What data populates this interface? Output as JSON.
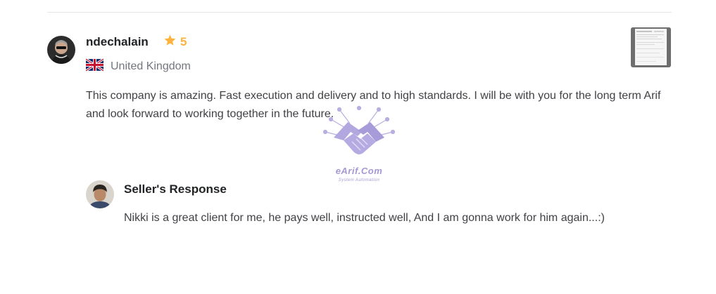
{
  "review": {
    "username": "ndechalain",
    "rating": "5",
    "country": "United Kingdom",
    "text": "This company is amazing. Fast execution and delivery and to high standards. I will be with you for the long term Arif and look forward to working together in the future."
  },
  "seller_response": {
    "heading": "Seller's Response",
    "text": "Nikki is a great client for me, he pays well, instructed well, And I am gonna work for him again...:)"
  },
  "watermark": {
    "title": "eArif.Com",
    "subtitle": "System Automation"
  },
  "colors": {
    "star": "#ffb33e",
    "text_primary": "#222325",
    "text_body": "#404145",
    "text_muted": "#74767e",
    "watermark": "#8c7cc8"
  },
  "icons": {
    "rating": "star-icon",
    "flag": "uk-flag-icon",
    "watermark": "handshake-icon"
  }
}
